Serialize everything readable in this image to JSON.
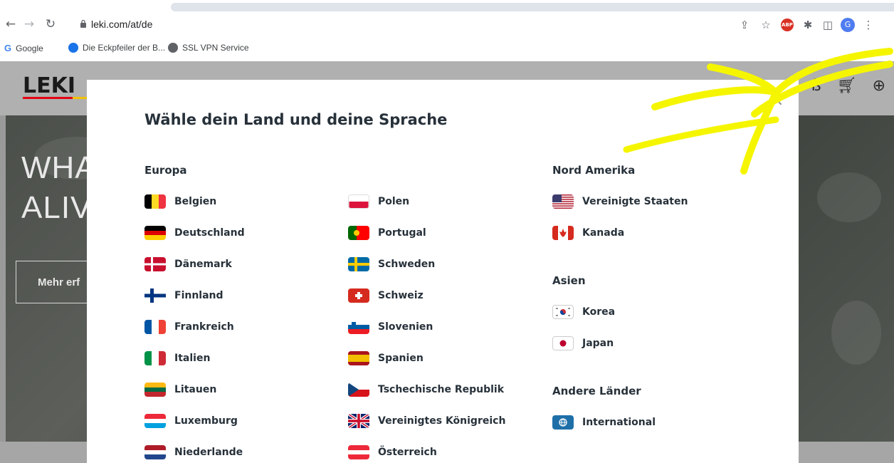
{
  "browser": {
    "url": "leki.com/at/de",
    "bookmarks": [
      {
        "label": "Google"
      },
      {
        "label": "Die Eckpfeiler der B..."
      },
      {
        "label": "SSL VPN Service"
      }
    ],
    "profile_initial": "G",
    "abp_label": "ABP"
  },
  "site": {
    "logo_text": "LEKI",
    "hero_line1": "WHA",
    "hero_line2": "ALIV",
    "hero_button": "Mehr erf"
  },
  "modal": {
    "title": "Wähle dein Land und deine Sprache",
    "close_symbol": "×",
    "europe_heading": "Europa",
    "europe_col1": [
      {
        "label": "Belgien",
        "flag": "be"
      },
      {
        "label": "Deutschland",
        "flag": "de"
      },
      {
        "label": "Dänemark",
        "flag": "dk"
      },
      {
        "label": "Finnland",
        "flag": "fi"
      },
      {
        "label": "Frankreich",
        "flag": "fr"
      },
      {
        "label": "Italien",
        "flag": "it"
      },
      {
        "label": "Litauen",
        "flag": "lt"
      },
      {
        "label": "Luxemburg",
        "flag": "lu"
      },
      {
        "label": "Niederlande",
        "flag": "nl"
      }
    ],
    "europe_col2": [
      {
        "label": "Polen",
        "flag": "pl"
      },
      {
        "label": "Portugal",
        "flag": "pt"
      },
      {
        "label": "Schweden",
        "flag": "se"
      },
      {
        "label": "Schweiz",
        "flag": "ch"
      },
      {
        "label": "Slovenien",
        "flag": "si"
      },
      {
        "label": "Spanien",
        "flag": "es"
      },
      {
        "label": "Tschechische Republik",
        "flag": "cz"
      },
      {
        "label": "Vereinigtes Königreich",
        "flag": "gb"
      },
      {
        "label": "Österreich",
        "flag": "at"
      }
    ],
    "north_america_heading": "Nord Amerika",
    "north_america": [
      {
        "label": "Vereinigte Staaten",
        "flag": "us"
      },
      {
        "label": "Kanada",
        "flag": "ca"
      }
    ],
    "asia_heading": "Asien",
    "asia": [
      {
        "label": "Korea",
        "flag": "kr"
      },
      {
        "label": "Japan",
        "flag": "jp"
      }
    ],
    "other_heading": "Andere Länder",
    "other": [
      {
        "label": "International",
        "flag": "intl"
      }
    ]
  },
  "colors": {
    "text_dark": "#27313a",
    "annotation_yellow": "#f5f500",
    "leki_red": "#e30613"
  }
}
